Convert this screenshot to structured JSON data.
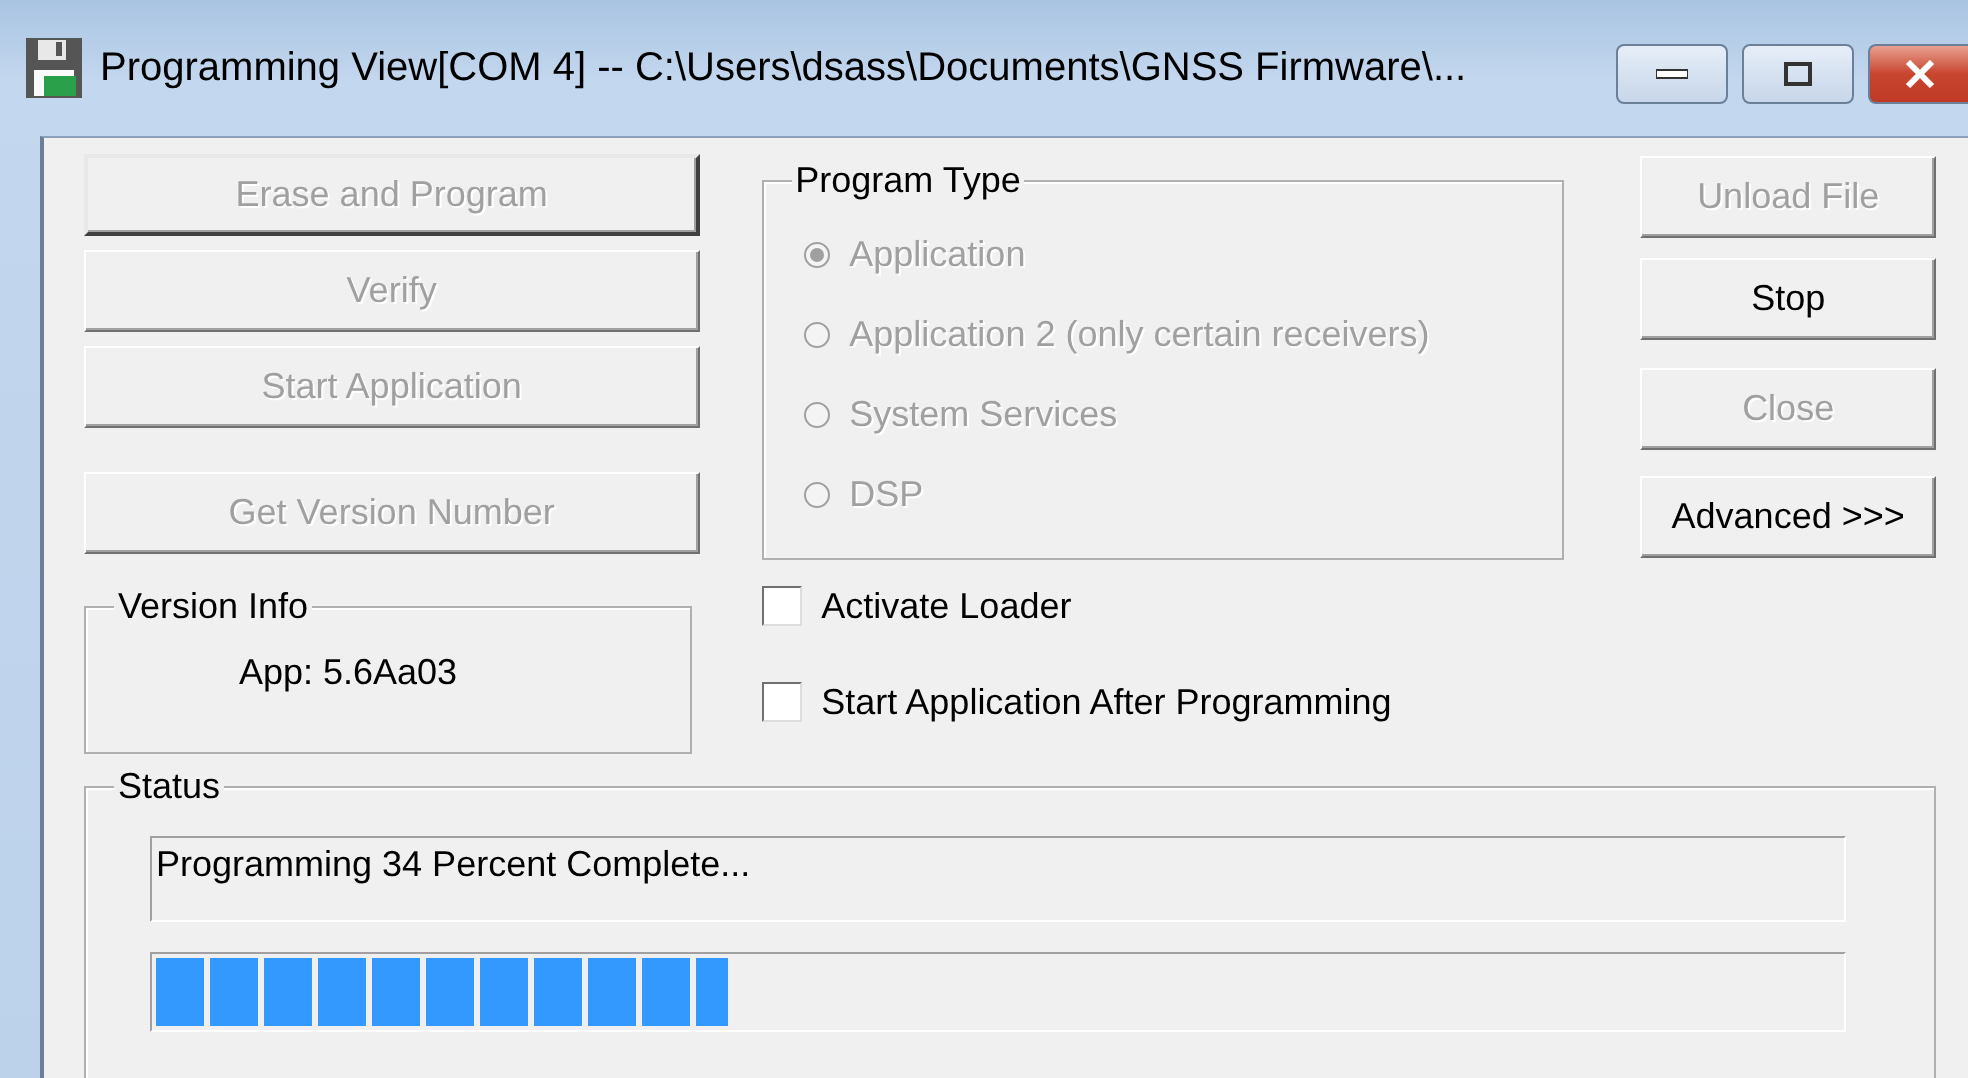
{
  "window": {
    "title": "Programming View[COM 4] -- C:\\Users\\dsass\\Documents\\GNSS Firmware\\..."
  },
  "left_buttons": [
    {
      "label": "Erase and Program",
      "disabled": true,
      "default": true
    },
    {
      "label": "Verify",
      "disabled": true,
      "default": false
    },
    {
      "label": "Start Application",
      "disabled": true,
      "default": false
    },
    {
      "label": "Get Version Number",
      "disabled": true,
      "default": false
    }
  ],
  "version_info": {
    "title": "Version Info",
    "text": "App: 5.6Aa03"
  },
  "program_type": {
    "title": "Program Type",
    "options": [
      {
        "label": "Application",
        "selected": true,
        "disabled": true
      },
      {
        "label": "Application 2 (only certain receivers)",
        "selected": false,
        "disabled": true
      },
      {
        "label": "System Services",
        "selected": false,
        "disabled": true
      },
      {
        "label": "DSP",
        "selected": false,
        "disabled": true
      }
    ]
  },
  "checkboxes": [
    {
      "label": "Activate Loader",
      "checked": false
    },
    {
      "label": "Start Application After Programming",
      "checked": false
    }
  ],
  "right_buttons": [
    {
      "label": "Unload File",
      "disabled": true
    },
    {
      "label": "Stop",
      "disabled": false
    },
    {
      "label": "Close",
      "disabled": true
    },
    {
      "label": "Advanced >>>",
      "disabled": false
    }
  ],
  "status": {
    "title": "Status",
    "message": "Programming 34 Percent Complete...",
    "progress": {
      "level": 0.34
    }
  }
}
